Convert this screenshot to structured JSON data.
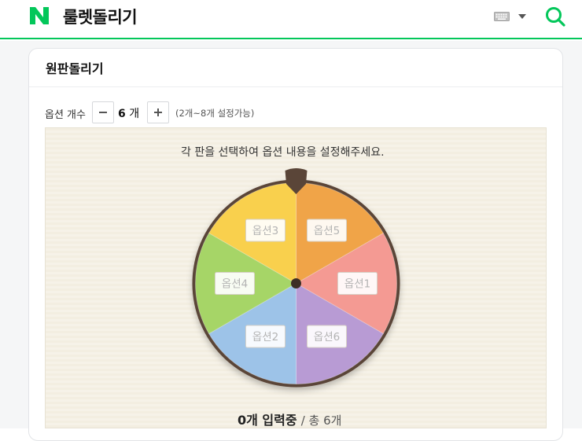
{
  "header": {
    "site_title": "룰렛돌리기",
    "search_icon": "search-icon",
    "keyboard_icon": "keyboard-icon",
    "brand_color": "#03c75a"
  },
  "card": {
    "title": "원판돌리기",
    "option_count_label": "옵션 개수",
    "option_count": "6",
    "option_count_unit": "개",
    "option_range": "(2개~8개 설정가능)",
    "instruction": "각 판을 선택하여 옵션 내용을 설정해주세요.",
    "status_count": "0개 입력중",
    "status_separator": "/",
    "status_total": "총 6개"
  },
  "wheel": {
    "slices": [
      {
        "label": "옵션1",
        "color": "#f49a93"
      },
      {
        "label": "옵션6",
        "color": "#b89bd4"
      },
      {
        "label": "옵션2",
        "color": "#9dc3e8"
      },
      {
        "label": "옵션4",
        "color": "#a6d567"
      },
      {
        "label": "옵션3",
        "color": "#f9d04d"
      },
      {
        "label": "옵션5",
        "color": "#f0a448"
      }
    ],
    "rim_color": "#5a4538"
  }
}
